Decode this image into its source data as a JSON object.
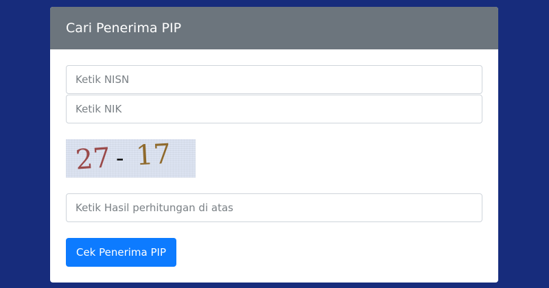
{
  "header": {
    "title": "Cari Penerima PIP"
  },
  "form": {
    "nisn_placeholder": "Ketik NISN",
    "nik_placeholder": "Ketik NIK",
    "captcha": {
      "left": "27",
      "operator": "-",
      "right": "17"
    },
    "hasil_placeholder": "Ketik Hasil perhitungan di atas",
    "submit_label": "Cek Penerima PIP"
  },
  "colors": {
    "background": "#172c7c",
    "header": "#6c757d",
    "button": "#0d7bff"
  }
}
